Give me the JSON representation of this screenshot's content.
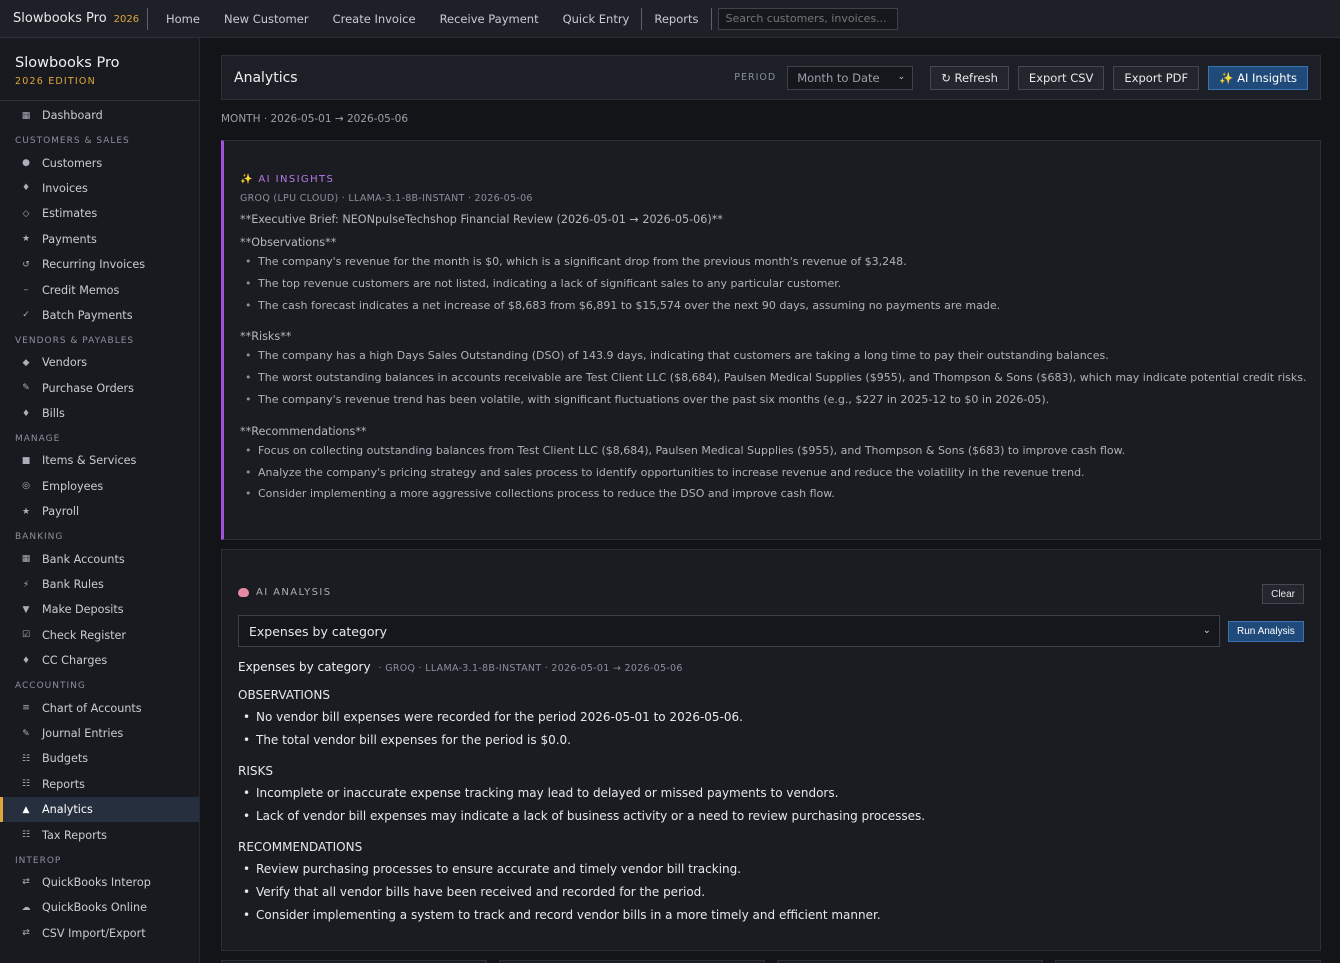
{
  "topbar": {
    "brand": "Slowbooks Pro",
    "year": "2026",
    "nav": [
      "Home",
      "New Customer",
      "Create Invoice",
      "Receive Payment",
      "Quick Entry"
    ],
    "nav2": [
      "Reports"
    ],
    "search_placeholder": "Search customers, invoices..."
  },
  "sidebar": {
    "title": "Slowbooks Pro",
    "edition": "2026 EDITION",
    "dashboard": {
      "icon": "dashboard-icon",
      "glyph": "▦",
      "label": "Dashboard"
    },
    "groups": [
      {
        "label": "CUSTOMERS & SALES",
        "items": [
          {
            "glyph": "●",
            "label": "Customers",
            "icon": "customers-icon"
          },
          {
            "glyph": "♦",
            "label": "Invoices",
            "icon": "invoices-icon"
          },
          {
            "glyph": "◇",
            "label": "Estimates",
            "icon": "estimates-icon"
          },
          {
            "glyph": "★",
            "label": "Payments",
            "icon": "payments-icon"
          },
          {
            "glyph": "↺",
            "label": "Recurring Invoices",
            "icon": "recurring-icon"
          },
          {
            "glyph": "–",
            "label": "Credit Memos",
            "icon": "credit-memo-icon"
          },
          {
            "glyph": "✓",
            "label": "Batch Payments",
            "icon": "batch-payments-icon"
          }
        ]
      },
      {
        "label": "VENDORS & PAYABLES",
        "items": [
          {
            "glyph": "◆",
            "label": "Vendors",
            "icon": "vendors-icon"
          },
          {
            "glyph": "✎",
            "label": "Purchase Orders",
            "icon": "purchase-orders-icon"
          },
          {
            "glyph": "♦",
            "label": "Bills",
            "icon": "bills-icon"
          }
        ]
      },
      {
        "label": "MANAGE",
        "items": [
          {
            "glyph": "■",
            "label": "Items & Services",
            "icon": "items-icon"
          },
          {
            "glyph": "◎",
            "label": "Employees",
            "icon": "employees-icon"
          },
          {
            "glyph": "★",
            "label": "Payroll",
            "icon": "payroll-icon"
          }
        ]
      },
      {
        "label": "BANKING",
        "items": [
          {
            "glyph": "▦",
            "label": "Bank Accounts",
            "icon": "bank-accounts-icon"
          },
          {
            "glyph": "⚡",
            "label": "Bank Rules",
            "icon": "bank-rules-icon"
          },
          {
            "glyph": "▼",
            "label": "Make Deposits",
            "icon": "deposits-icon"
          },
          {
            "glyph": "☑",
            "label": "Check Register",
            "icon": "check-register-icon"
          },
          {
            "glyph": "♦",
            "label": "CC Charges",
            "icon": "cc-charges-icon"
          }
        ]
      },
      {
        "label": "ACCOUNTING",
        "items": [
          {
            "glyph": "≡",
            "label": "Chart of Accounts",
            "icon": "chart-of-accounts-icon"
          },
          {
            "glyph": "✎",
            "label": "Journal Entries",
            "icon": "journal-icon"
          },
          {
            "glyph": "☷",
            "label": "Budgets",
            "icon": "budgets-icon"
          },
          {
            "glyph": "☷",
            "label": "Reports",
            "icon": "reports-icon"
          },
          {
            "glyph": "▲",
            "label": "Analytics",
            "icon": "analytics-icon",
            "active": true
          },
          {
            "glyph": "☷",
            "label": "Tax Reports",
            "icon": "tax-reports-icon"
          }
        ]
      },
      {
        "label": "INTEROP",
        "items": [
          {
            "glyph": "⇄",
            "label": "QuickBooks Interop",
            "icon": "qb-interop-icon"
          },
          {
            "glyph": "☁",
            "label": "QuickBooks Online",
            "icon": "qb-online-icon"
          },
          {
            "glyph": "⇄",
            "label": "CSV Import/Export",
            "icon": "csv-icon"
          }
        ]
      }
    ]
  },
  "header": {
    "title": "Analytics",
    "period_label": "PERIOD",
    "period_value": "Month to Date",
    "refresh": "↻ Refresh",
    "export_csv": "Export CSV",
    "export_pdf": "Export PDF",
    "ai_insights": "✨ AI Insights"
  },
  "subline": "MONTH · 2026-05-01 → 2026-05-06",
  "insights": {
    "title": "✨ AI INSIGHTS",
    "meta": "GROQ (LPU CLOUD) · LLAMA-3.1-8B-INSTANT · 2026-05-06",
    "brief": "**Executive Brief: NEONpulseTechshop Financial Review (2026-05-01 → 2026-05-06)**",
    "sections": [
      {
        "heading": "**Observations**",
        "items": [
          "The company's revenue for the month is $0, which is a significant drop from the previous month's revenue of $3,248.",
          "The top revenue customers are not listed, indicating a lack of significant sales to any particular customer.",
          "The cash forecast indicates a net increase of $8,683 from $6,891 to $15,574 over the next 90 days, assuming no payments are made."
        ]
      },
      {
        "heading": "**Risks**",
        "items": [
          "The company has a high Days Sales Outstanding (DSO) of 143.9 days, indicating that customers are taking a long time to pay their outstanding balances.",
          "The worst outstanding balances in accounts receivable are Test Client LLC ($8,684), Paulsen Medical Supplies ($955), and Thompson & Sons ($683), which may indicate potential credit risks.",
          "The company's revenue trend has been volatile, with significant fluctuations over the past six months (e.g., $227 in 2025-12 to $0 in 2026-05)."
        ]
      },
      {
        "heading": "**Recommendations**",
        "items": [
          "Focus on collecting outstanding balances from Test Client LLC ($8,684), Paulsen Medical Supplies ($955), and Thompson & Sons ($683) to improve cash flow.",
          "Analyze the company's pricing strategy and sales process to identify opportunities to increase revenue and reduce the volatility in the revenue trend.",
          "Consider implementing a more aggressive collections process to reduce the DSO and improve cash flow."
        ]
      }
    ]
  },
  "analysis": {
    "title": "AI ANALYSIS",
    "clear": "Clear",
    "select_value": "Expenses by category",
    "run": "Run Analysis",
    "result_title": "Expenses by category",
    "result_meta": "· GROQ · LLAMA-3.1-8B-INSTANT · 2026-05-01 → 2026-05-06",
    "sections": [
      {
        "heading": "OBSERVATIONS",
        "items": [
          "No vendor bill expenses were recorded for the period 2026-05-01 to 2026-05-06.",
          "The total vendor bill expenses for the period is $0.0."
        ]
      },
      {
        "heading": "RISKS",
        "items": [
          "Incomplete or inaccurate expense tracking may lead to delayed or missed payments to vendors.",
          "Lack of vendor bill expenses may indicate a lack of business activity or a need to review purchasing processes."
        ]
      },
      {
        "heading": "RECOMMENDATIONS",
        "items": [
          "Review purchasing processes to ensure accurate and timely vendor bill tracking.",
          "Verify that all vendor bills have been received and recorded for the period.",
          "Consider implementing a system to track and record vendor bills in a more timely and efficient manner."
        ]
      }
    ]
  }
}
